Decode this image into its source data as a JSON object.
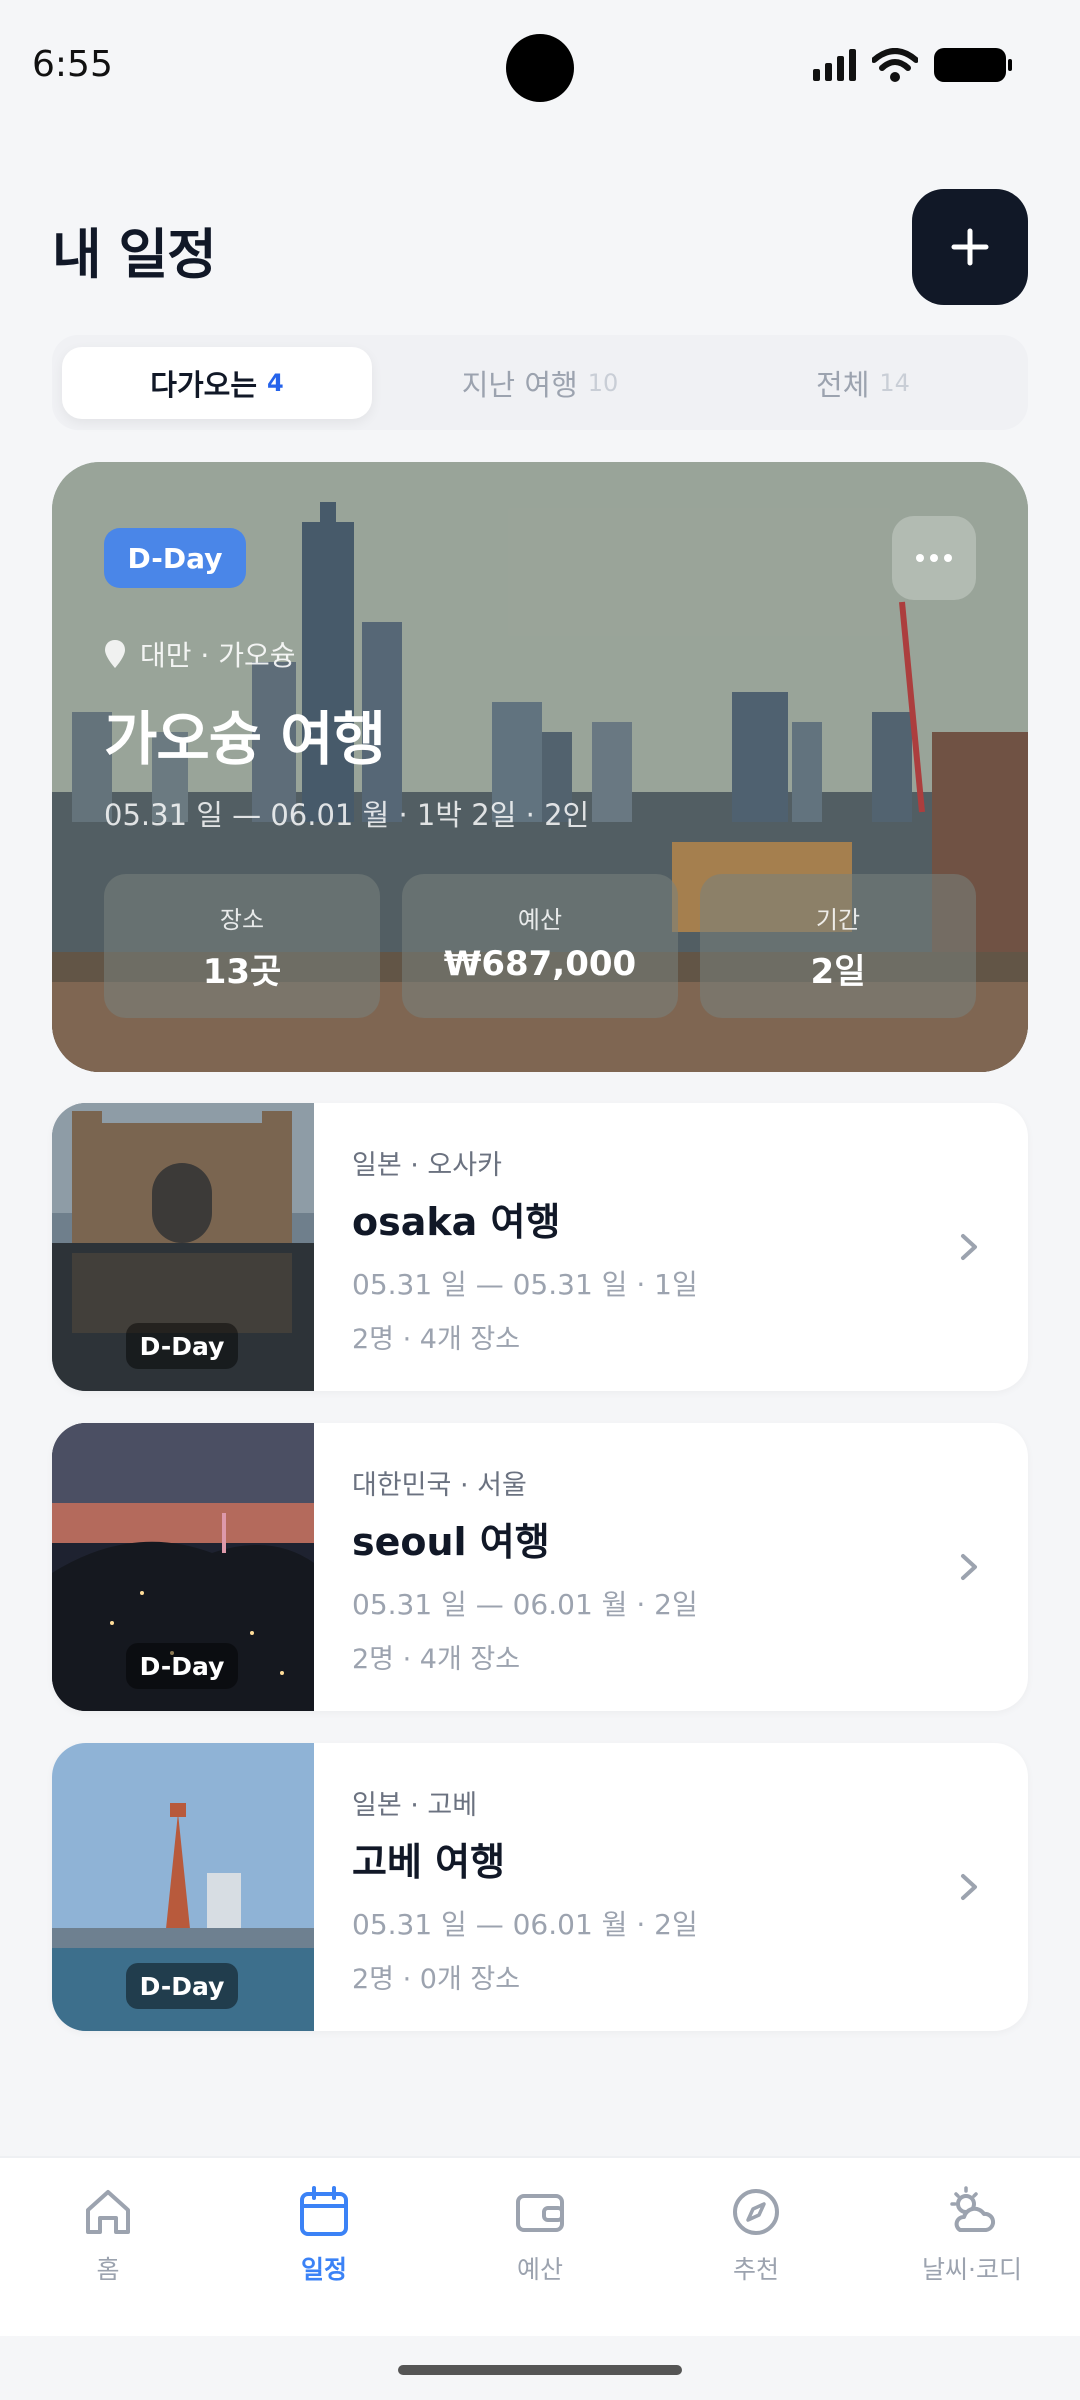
{
  "status_bar": {
    "time": "6:55"
  },
  "header": {
    "title": "내 일정",
    "add_button": "+"
  },
  "tabs": [
    {
      "label": "다가오는",
      "count": "4",
      "active": true
    },
    {
      "label": "지난 여행",
      "count": "10",
      "active": false
    },
    {
      "label": "전체",
      "count": "14",
      "active": false
    }
  ],
  "featured_trip": {
    "badge": "D-Day",
    "location": "대만 · 가오슝",
    "title": "가오슝 여행",
    "dates": "05.31 일 — 06.01 월 · 1박 2일 · 2인",
    "stats": [
      {
        "label": "장소",
        "value": "13곳"
      },
      {
        "label": "예산",
        "value": "₩687,000"
      },
      {
        "label": "기간",
        "value": "2일"
      }
    ]
  },
  "trips": [
    {
      "badge": "D-Day",
      "location": "일본 · 오사카",
      "title": "osaka 여행",
      "dates": "05.31 일 — 05.31 일 · 1일",
      "meta": "2명 · 4개 장소"
    },
    {
      "badge": "D-Day",
      "location": "대한민국 · 서울",
      "title": "seoul 여행",
      "dates": "05.31 일 — 06.01 월 · 2일",
      "meta": "2명 · 4개 장소"
    },
    {
      "badge": "D-Day",
      "location": "일본 · 고베",
      "title": "고베 여행",
      "dates": "05.31 일 — 06.01 월 · 2일",
      "meta": "2명 · 0개 장소"
    }
  ],
  "bottom_nav": [
    {
      "label": "홈",
      "icon": "home-icon",
      "active": false
    },
    {
      "label": "일정",
      "icon": "calendar-icon",
      "active": true
    },
    {
      "label": "예산",
      "icon": "wallet-icon",
      "active": false
    },
    {
      "label": "추천",
      "icon": "compass-icon",
      "active": false
    },
    {
      "label": "날씨·코디",
      "icon": "weather-icon",
      "active": false
    }
  ],
  "colors": {
    "accent": "#3b82f6",
    "dark": "#111827",
    "badge_blue": "#4a86e8"
  }
}
